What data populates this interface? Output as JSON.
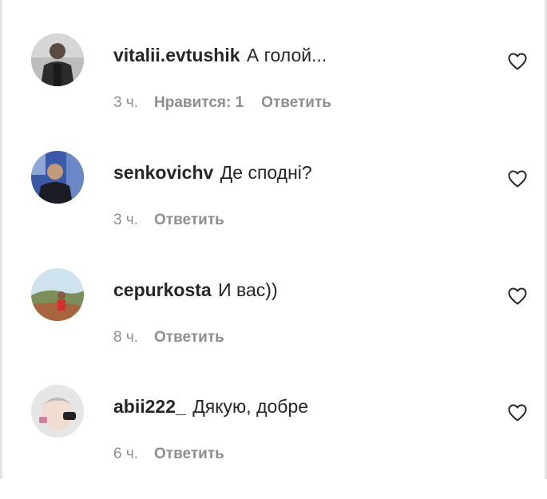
{
  "comments": [
    {
      "username": "vitalii.evtushik",
      "text": "А голой...",
      "time": "3 ч.",
      "likes": "Нравится: 1",
      "reply": "Ответить",
      "avatar": "person-dark-clothes"
    },
    {
      "username": "senkovichv",
      "text": "Де сподні?",
      "time": "3 ч.",
      "likes": "",
      "reply": "Ответить",
      "avatar": "person-blue-background"
    },
    {
      "username": "cepurkosta",
      "text": "И вас))",
      "time": "8 ч.",
      "likes": "",
      "reply": "Ответить",
      "avatar": "person-outdoor-landscape"
    },
    {
      "username": "abii222_",
      "text": "Дякую, добре",
      "time": "6 ч.",
      "likes": "",
      "reply": "Ответить",
      "avatar": "baby-photo"
    }
  ],
  "icons": {
    "like": "heart-outline-icon"
  },
  "colors": {
    "text": "#262626",
    "meta": "#8e8e8e",
    "background": "#ffffff"
  }
}
